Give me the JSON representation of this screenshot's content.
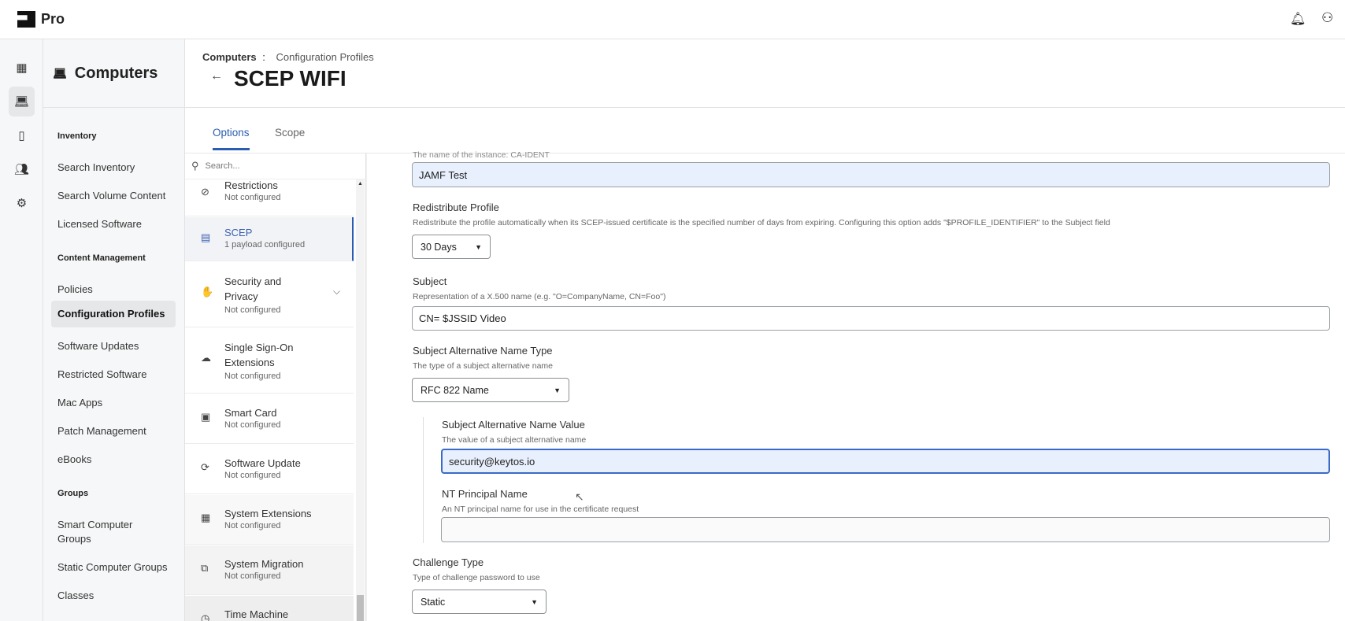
{
  "app": {
    "title": "Pro",
    "logo": "jamf-logo",
    "icons": [
      "bell-icon",
      "user-icon"
    ]
  },
  "rail": [
    "dashboard-icon",
    "computer-icon",
    "devices-icon",
    "users-icon",
    "settings-icon"
  ],
  "sidebar": {
    "title": "Computers",
    "sections": [
      {
        "label": "Inventory",
        "items": [
          "Search Inventory",
          "Search Volume Content",
          "Licensed Software"
        ]
      },
      {
        "label": "Content Management",
        "items": [
          "Policies",
          "Configuration Profiles",
          "Software Updates",
          "Restricted Software",
          "Mac Apps",
          "Patch Management",
          "eBooks"
        ]
      },
      {
        "label": "Groups",
        "items": [
          "Smart Computer Groups",
          "Static Computer Groups",
          "Classes"
        ]
      }
    ],
    "active": "Configuration Profiles"
  },
  "header": {
    "breadcrumb_root": "Computers",
    "breadcrumb_sep": ":",
    "breadcrumb_current": "Configuration Profiles",
    "title": "SCEP WIFI"
  },
  "tabs": [
    "Options",
    "Scope"
  ],
  "payloads": {
    "search_placeholder": "Search...",
    "items": [
      {
        "name": "Restrictions",
        "status": "Not configured",
        "icon": "⊘"
      },
      {
        "name": "SCEP",
        "status": "1 payload configured",
        "icon": "▤",
        "active": true
      },
      {
        "name": "Security and Privacy",
        "status": "Not configured",
        "icon": "✋"
      },
      {
        "name": "Single Sign-On Extensions",
        "status": "Not configured",
        "icon": "☁"
      },
      {
        "name": "Smart Card",
        "status": "Not configured",
        "icon": "▣"
      },
      {
        "name": "Software Update",
        "status": "Not configured",
        "icon": "⟳"
      },
      {
        "name": "System Extensions",
        "status": "Not configured",
        "icon": "▦"
      },
      {
        "name": "System Migration",
        "status": "Not configured",
        "icon": "⧉"
      },
      {
        "name": "Time Machine",
        "status": "",
        "icon": "◷"
      }
    ]
  },
  "form": {
    "instance_desc": "The name of the instance: CA-IDENT",
    "instance_value": "JAMF Test",
    "redistribute_label": "Redistribute Profile",
    "redistribute_desc": "Redistribute the profile automatically when its SCEP-issued certificate is the specified number of days from expiring. Configuring this option adds \"$PROFILE_IDENTIFIER\" to the Subject field",
    "redistribute_value": "30 Days",
    "subject_label": "Subject",
    "subject_desc": "Representation of a X.500 name (e.g. \"O=CompanyName, CN=Foo\")",
    "subject_value": "CN= $JSSID Video",
    "san_type_label": "Subject Alternative Name Type",
    "san_type_desc": "The type of a subject alternative name",
    "san_type_value": "RFC 822 Name",
    "san_value_label": "Subject Alternative Name Value",
    "san_value_desc": "The value of a subject alternative name",
    "san_value": "security@keytos.io",
    "nt_label": "NT Principal Name",
    "nt_desc": "An NT principal name for use in the certificate request",
    "nt_value": "",
    "challenge_label": "Challenge Type",
    "challenge_desc": "Type of challenge password to use",
    "challenge_value": "Static"
  },
  "colors": {
    "accent": "#2a5db0",
    "filled_input": "#e9f0fd"
  }
}
